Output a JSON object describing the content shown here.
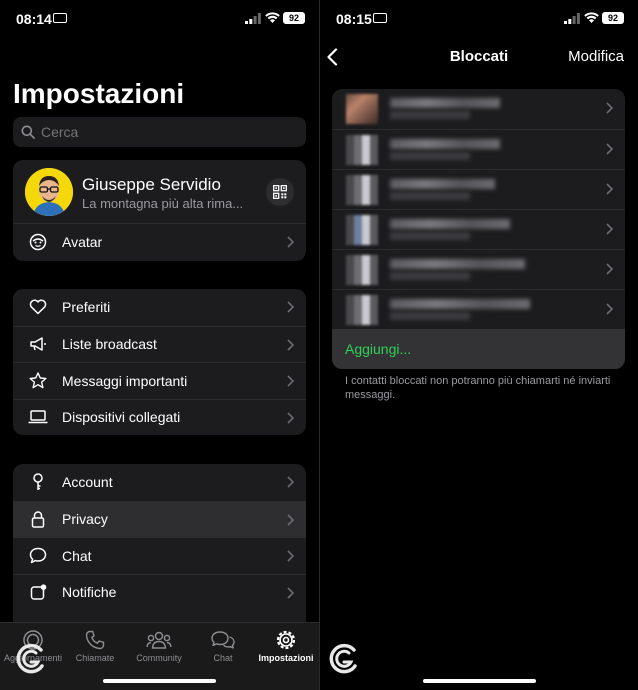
{
  "left": {
    "status": {
      "time": "08:14",
      "battery": "92"
    },
    "title": "Impostazioni",
    "search_placeholder": "Cerca",
    "profile": {
      "name": "Giuseppe Servidio",
      "status": "La montagna più alta rima..."
    },
    "group1": [
      {
        "label": "Avatar",
        "icon": "avatar-icon"
      }
    ],
    "group2": [
      {
        "label": "Preferiti",
        "icon": "heart-icon"
      },
      {
        "label": "Liste broadcast",
        "icon": "megaphone-icon"
      },
      {
        "label": "Messaggi importanti",
        "icon": "star-icon"
      },
      {
        "label": "Dispositivi collegati",
        "icon": "laptop-icon"
      }
    ],
    "group3": [
      {
        "label": "Account",
        "icon": "key-icon"
      },
      {
        "label": "Privacy",
        "icon": "lock-icon",
        "selected": true
      },
      {
        "label": "Chat",
        "icon": "chat-bubble-icon"
      },
      {
        "label": "Notifiche",
        "icon": "notification-icon"
      }
    ],
    "tabs": [
      {
        "label": "Aggiornamenti",
        "icon": "updates-icon"
      },
      {
        "label": "Chiamate",
        "icon": "phone-icon"
      },
      {
        "label": "Community",
        "icon": "community-icon"
      },
      {
        "label": "Chat",
        "icon": "chats-icon"
      },
      {
        "label": "Impostazioni",
        "icon": "settings-icon",
        "active": true
      }
    ]
  },
  "right": {
    "status": {
      "time": "08:15",
      "battery": "92"
    },
    "nav": {
      "title": "Bloccati",
      "edit": "Modifica"
    },
    "blocked_contacts_count": 6,
    "add_label": "Aggiungi...",
    "footnote": "I contatti bloccati non potranno più chiamarti né inviarti messaggi."
  },
  "colors": {
    "accent_green": "#30d158",
    "card_bg": "#1c1c1e",
    "avatar_yellow": "#f5d80a"
  }
}
